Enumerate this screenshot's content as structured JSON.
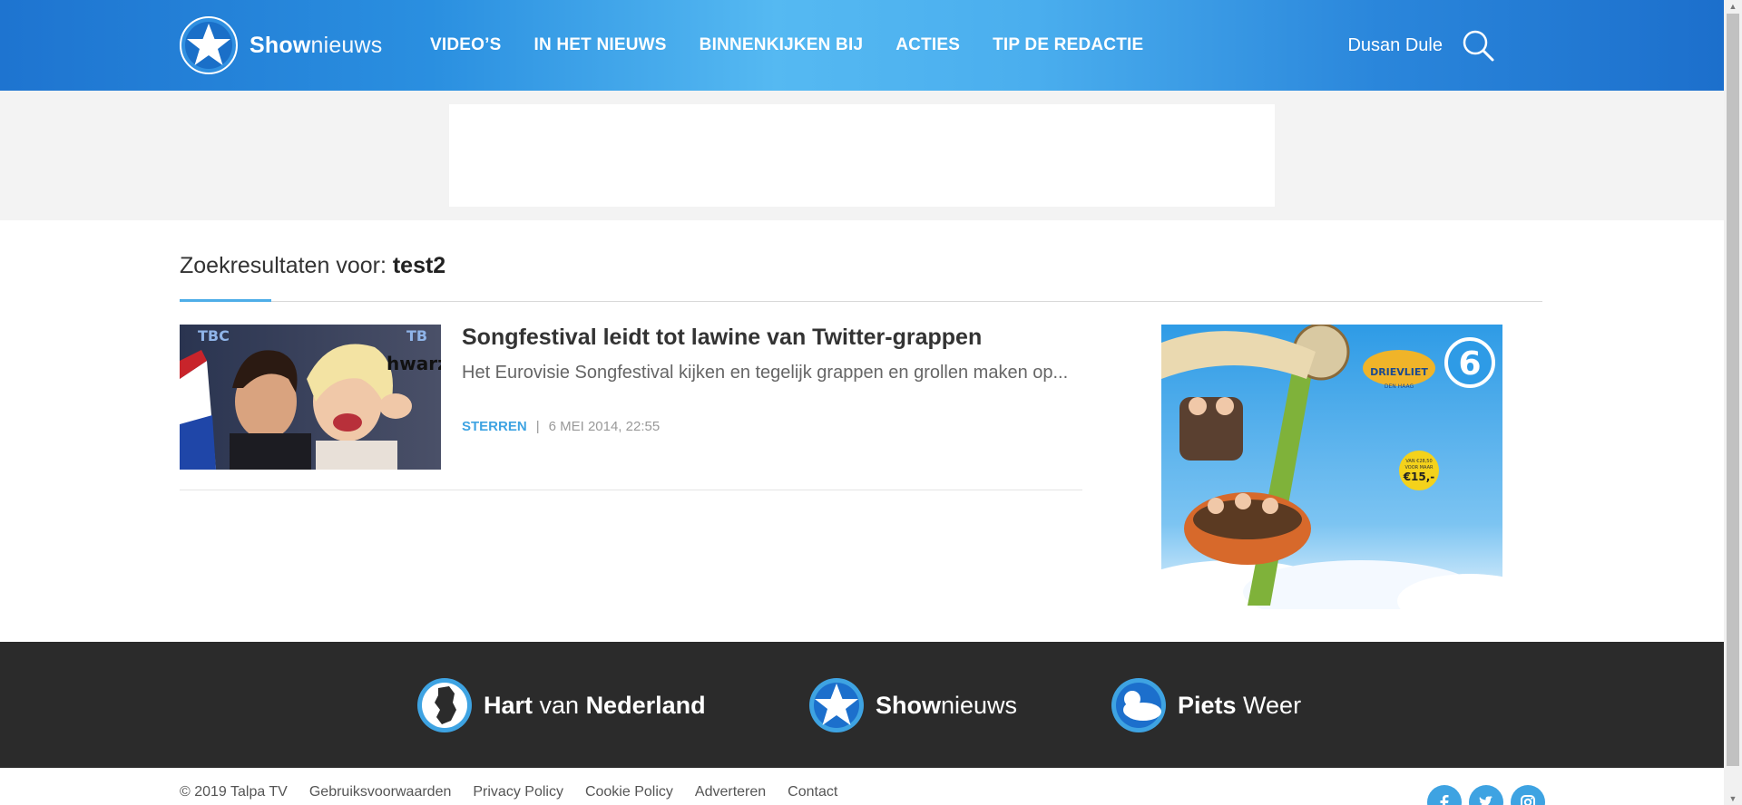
{
  "header": {
    "logo_bold": "Show",
    "logo_light": "nieuws",
    "nav": [
      "VIDEO’S",
      "IN HET NIEUWS",
      "BINNENKIJKEN BIJ",
      "ACTIES",
      "TIP DE REDACTIE"
    ],
    "user_name": "Dusan Dule",
    "search_icon": "search-icon"
  },
  "search": {
    "label": "Zoekresultaten voor: ",
    "query": "test2"
  },
  "results": [
    {
      "title": "Songfestival leidt tot lawine van Twitter-grappen",
      "description": "Het Eurovisie Songfestival kijken en tegelijk grappen en grollen maken op...",
      "category": "STERREN",
      "separator": "|",
      "date": "6 MEI 2014, 22:55"
    }
  ],
  "side_ad": {
    "park_name": "DRIEVLIET",
    "park_sub": "DEN HAAG",
    "price_top": "VAN €28,50",
    "price_mid": "VOOR MAAR",
    "price": "€15,-",
    "channel_logo": "6"
  },
  "footer": {
    "brands": [
      {
        "bold": "Hart",
        "light": " van ",
        "bold2": "Nederland",
        "icon": "netherlands-map-icon"
      },
      {
        "bold": "Show",
        "light": "nieuws",
        "bold2": "",
        "icon": "star-icon"
      },
      {
        "bold": "Piets",
        "light": " Weer",
        "bold2": "",
        "icon": "cloud-sun-icon"
      }
    ],
    "copyright": "© 2019 Talpa TV",
    "links": [
      "Gebruiksvoorwaarden",
      "Privacy Policy",
      "Cookie Policy",
      "Adverteren",
      "Contact"
    ],
    "socials": [
      "facebook-icon",
      "twitter-icon",
      "instagram-icon"
    ]
  },
  "colors": {
    "accent": "#3ea3e2",
    "header_dark": "#1e74d0",
    "header_light": "#55b9f2",
    "footer_bg": "#2b2b2b"
  }
}
